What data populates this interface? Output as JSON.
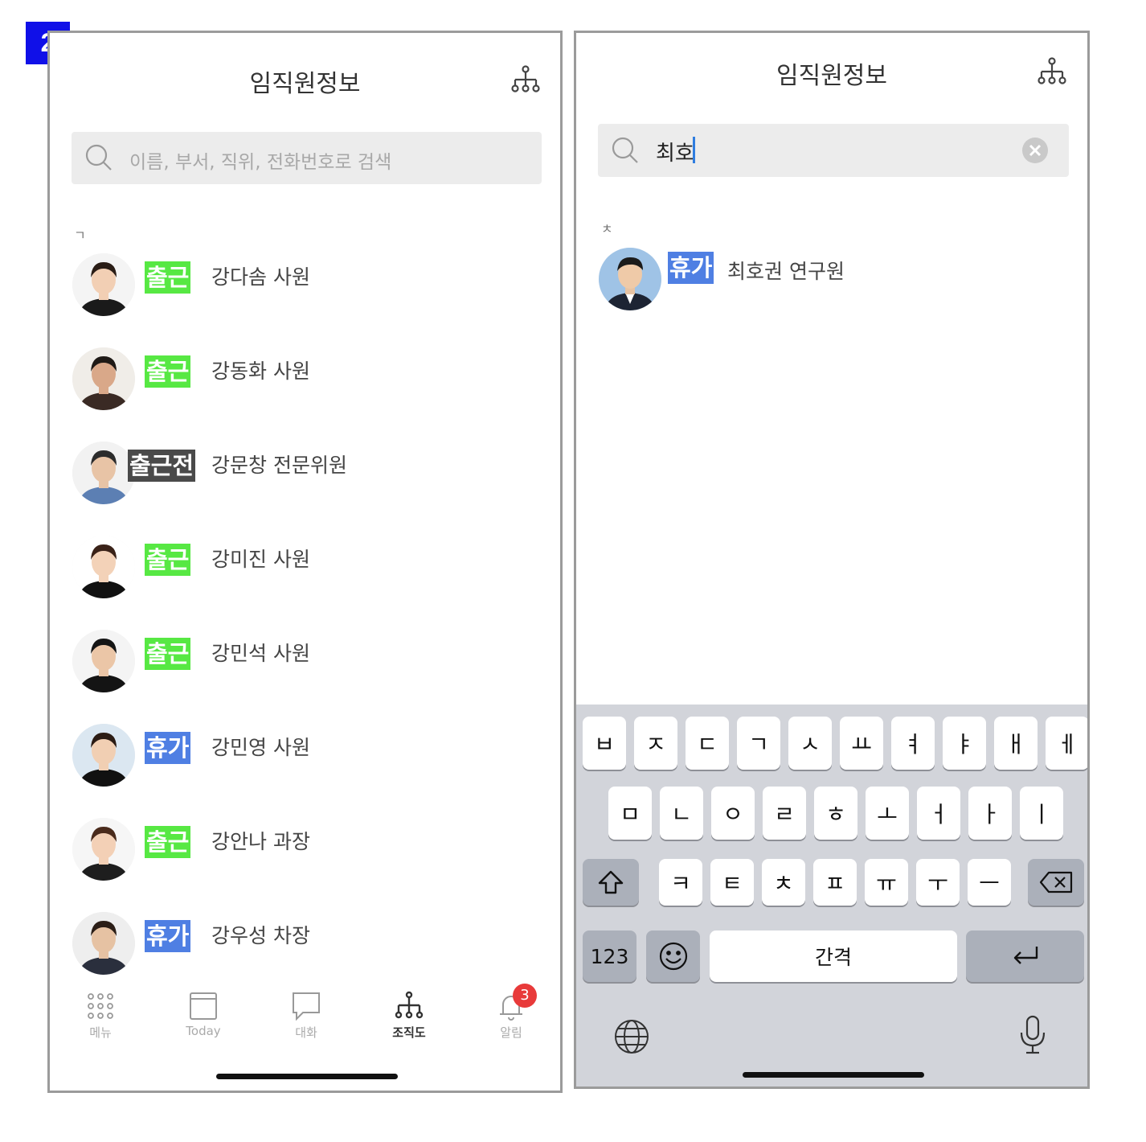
{
  "figure_number": "2",
  "left": {
    "title": "임직원정보",
    "search_placeholder": "이름, 부서, 직위, 전화번호로 검색",
    "section": "ㄱ",
    "employees": [
      {
        "status": "출근",
        "status_type": "work",
        "name": "강다솜 사원"
      },
      {
        "status": "출근",
        "status_type": "work",
        "name": "강동화 사원"
      },
      {
        "status": "출근전",
        "status_type": "pre",
        "name": "강문창 전문위원"
      },
      {
        "status": "출근",
        "status_type": "work",
        "name": "강미진 사원"
      },
      {
        "status": "출근",
        "status_type": "work",
        "name": "강민석 사원"
      },
      {
        "status": "휴가",
        "status_type": "leave",
        "name": "강민영 사원"
      },
      {
        "status": "출근",
        "status_type": "work",
        "name": "강안나 과장"
      },
      {
        "status": "휴가",
        "status_type": "leave",
        "name": "강우성 차장"
      }
    ],
    "tabs": [
      {
        "label": "메뉴",
        "icon": "grid-icon"
      },
      {
        "label": "Today",
        "icon": "calendar-icon"
      },
      {
        "label": "대화",
        "icon": "chat-icon"
      },
      {
        "label": "조직도",
        "icon": "org-chart-icon",
        "active": true
      },
      {
        "label": "알림",
        "icon": "bell-icon",
        "badge": "3"
      }
    ]
  },
  "right": {
    "title": "임직원정보",
    "search_value": "최호",
    "section": "ㅊ",
    "result": {
      "status": "휴가",
      "status_type": "leave",
      "name": "최호권 연구원"
    },
    "keyboard": {
      "row1": [
        "ㅂ",
        "ㅈ",
        "ㄷ",
        "ㄱ",
        "ㅅ",
        "ㅛ",
        "ㅕ",
        "ㅑ",
        "ㅐ",
        "ㅔ"
      ],
      "row2": [
        "ㅁ",
        "ㄴ",
        "ㅇ",
        "ㄹ",
        "ㅎ",
        "ㅗ",
        "ㅓ",
        "ㅏ",
        "ㅣ"
      ],
      "row3": [
        "ㅋ",
        "ㅌ",
        "ㅊ",
        "ㅍ",
        "ㅠ",
        "ㅜ",
        "ㅡ"
      ],
      "numbers": "123",
      "space": "간격"
    }
  },
  "colors": {
    "work": "#57e843",
    "pre": "#4a4a4a",
    "leave": "#4f7fe3",
    "badge_blue": "#1010e8",
    "notif": "#e83a3a"
  }
}
